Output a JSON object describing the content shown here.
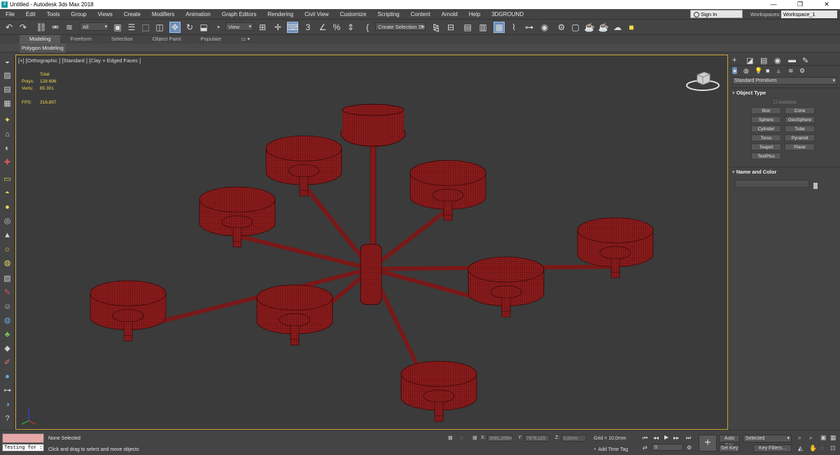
{
  "window": {
    "title": "Untitled - Autodesk 3ds Max 2018",
    "controls": [
      "—",
      "❐",
      "✕"
    ]
  },
  "menu": [
    "File",
    "Edit",
    "Tools",
    "Group",
    "Views",
    "Create",
    "Modifiers",
    "Animation",
    "Graph Editors",
    "Rendering",
    "Civil View",
    "Customize",
    "Scripting",
    "Content",
    "Arnold",
    "Help",
    "3DGROUND"
  ],
  "account": {
    "signin": "Sign In",
    "workspaces_label": "Workspaces:",
    "workspace": "Workspace_1"
  },
  "toolbar": {
    "selection_filter": "All",
    "ref_coord": "View",
    "selection_set": "Create Selection Se"
  },
  "ribbon": {
    "tabs": [
      "Modeling",
      "Freeform",
      "Selection",
      "Object Paint",
      "Populate"
    ],
    "active": "Modeling",
    "panel": "Polygon Modeling"
  },
  "viewport": {
    "label": "[+] [Orthographic ] [Standard ] [Clay + Edged Faces ]",
    "stats": {
      "heading": "Total",
      "polys_label": "Polys:",
      "polys": "128 696",
      "verts_label": "Verts:",
      "verts": "65 301",
      "fps_label": "FPS:",
      "fps": "316,897"
    },
    "mesh_color": "#8d1c1c"
  },
  "command_panel": {
    "dropdown": "Standard Primitives",
    "object_type_title": "Object Type",
    "autogrid": "AutoGrid",
    "buttons": [
      "Box",
      "Cone",
      "Sphere",
      "GeoSphere",
      "Cylinder",
      "Tube",
      "Torus",
      "Pyramid",
      "Teapot",
      "Plane",
      "TextPlus"
    ],
    "name_and_color_title": "Name and Color"
  },
  "status": {
    "maxscript_input": "Testing for :",
    "selection": "None Selected",
    "prompt": "Click and drag to select and move objects",
    "x_label": "X:",
    "x": "3081,209m",
    "y_label": "Y:",
    "y": "7676,125",
    "z_label": "Z:",
    "z": "0,0mm",
    "grid": "Grid = 10,0mm",
    "add_time_tag": "Add Time Tag",
    "frame": "0",
    "auto_key": "Auto Key",
    "set_key": "Set Key",
    "key_mode": "Selected",
    "key_filters": "Key Filters..."
  }
}
